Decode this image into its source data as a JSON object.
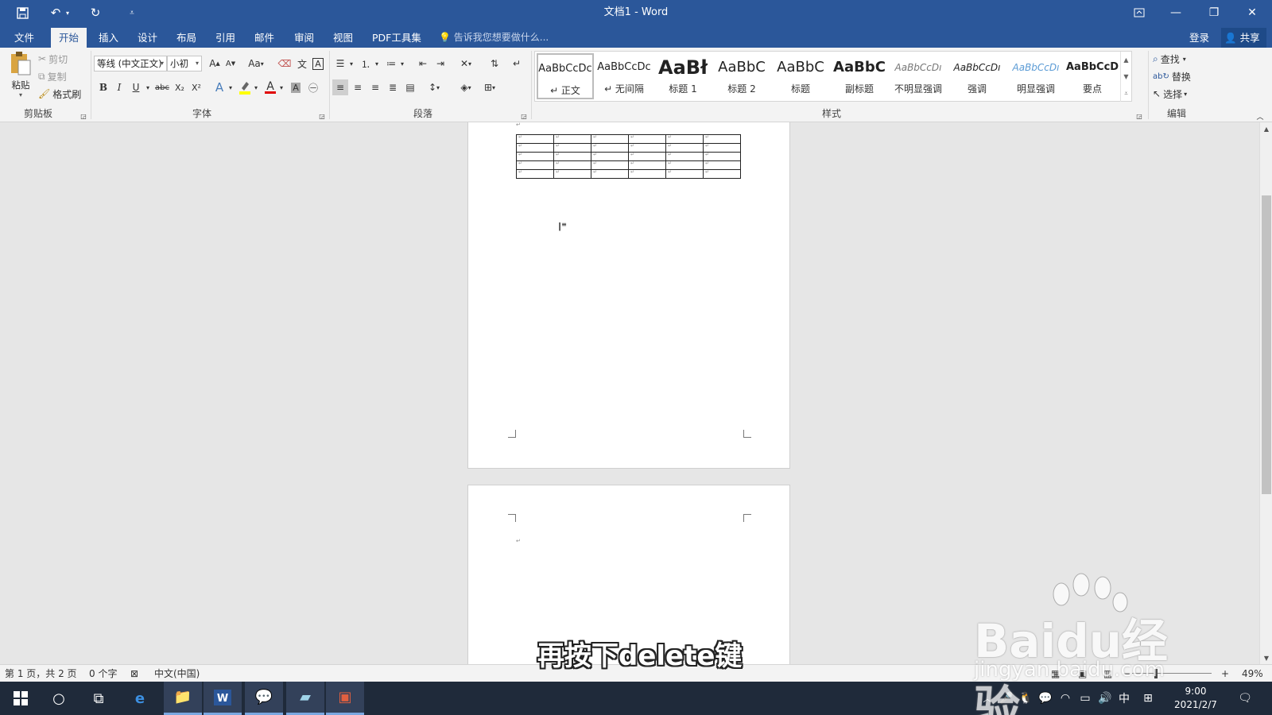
{
  "window": {
    "title": "文档1 - Word",
    "qa_customize": "⩡"
  },
  "tabs": [
    "文件",
    "开始",
    "插入",
    "设计",
    "布局",
    "引用",
    "邮件",
    "审阅",
    "视图",
    "PDF工具集"
  ],
  "active_tab": "开始",
  "tell_me": "告诉我您想要做什么...",
  "account": {
    "login": "登录",
    "share": "共享"
  },
  "clipboard": {
    "paste": "粘贴",
    "cut": "剪切",
    "copy": "复制",
    "format_painter": "格式刷",
    "label": "剪贴板"
  },
  "font": {
    "name": "等线 (中文正文)",
    "size": "小初",
    "label": "字体",
    "case": "Aa",
    "bold": "B",
    "italic": "I",
    "underline": "U",
    "strike": "abc",
    "sub": "X₂",
    "sup": "X²",
    "text_effect": "A",
    "font_color": "A",
    "char_shade": "A"
  },
  "paragraph": {
    "label": "段落"
  },
  "styles": {
    "label": "样式",
    "items": [
      {
        "sample": "AaBbCcDc",
        "name": "↵ 正文"
      },
      {
        "sample": "AaBbCcDc",
        "name": "↵ 无间隔"
      },
      {
        "sample": "AaBł",
        "name": "标题 1"
      },
      {
        "sample": "AaBbC",
        "name": "标题 2"
      },
      {
        "sample": "AaBbC",
        "name": "标题"
      },
      {
        "sample": "AaBbC",
        "name": "副标题"
      },
      {
        "sample": "AaBbCcDı",
        "name": "不明显强调"
      },
      {
        "sample": "AaBbCcDı",
        "name": "强调"
      },
      {
        "sample": "AaBbCcDı",
        "name": "明显强调"
      },
      {
        "sample": "AaBbCcD",
        "name": "要点"
      }
    ]
  },
  "editing": {
    "find": "查找",
    "replace": "替换",
    "select": "选择",
    "label": "编辑"
  },
  "status": {
    "page": "第 1 页，共 2 页",
    "words": "0 个字",
    "language": "中文(中国)",
    "zoom": "49%"
  },
  "taskbar": {
    "time": "9:00",
    "date": "2021/2/7",
    "ime": "中"
  },
  "subtitle": "再按下delete键",
  "watermark": {
    "main": "Baidu经验",
    "sub": "jingyan.baidu.com"
  },
  "colors": {
    "brand": "#2b579a",
    "highlight": "#ffff00",
    "font_red": "#e00000"
  }
}
